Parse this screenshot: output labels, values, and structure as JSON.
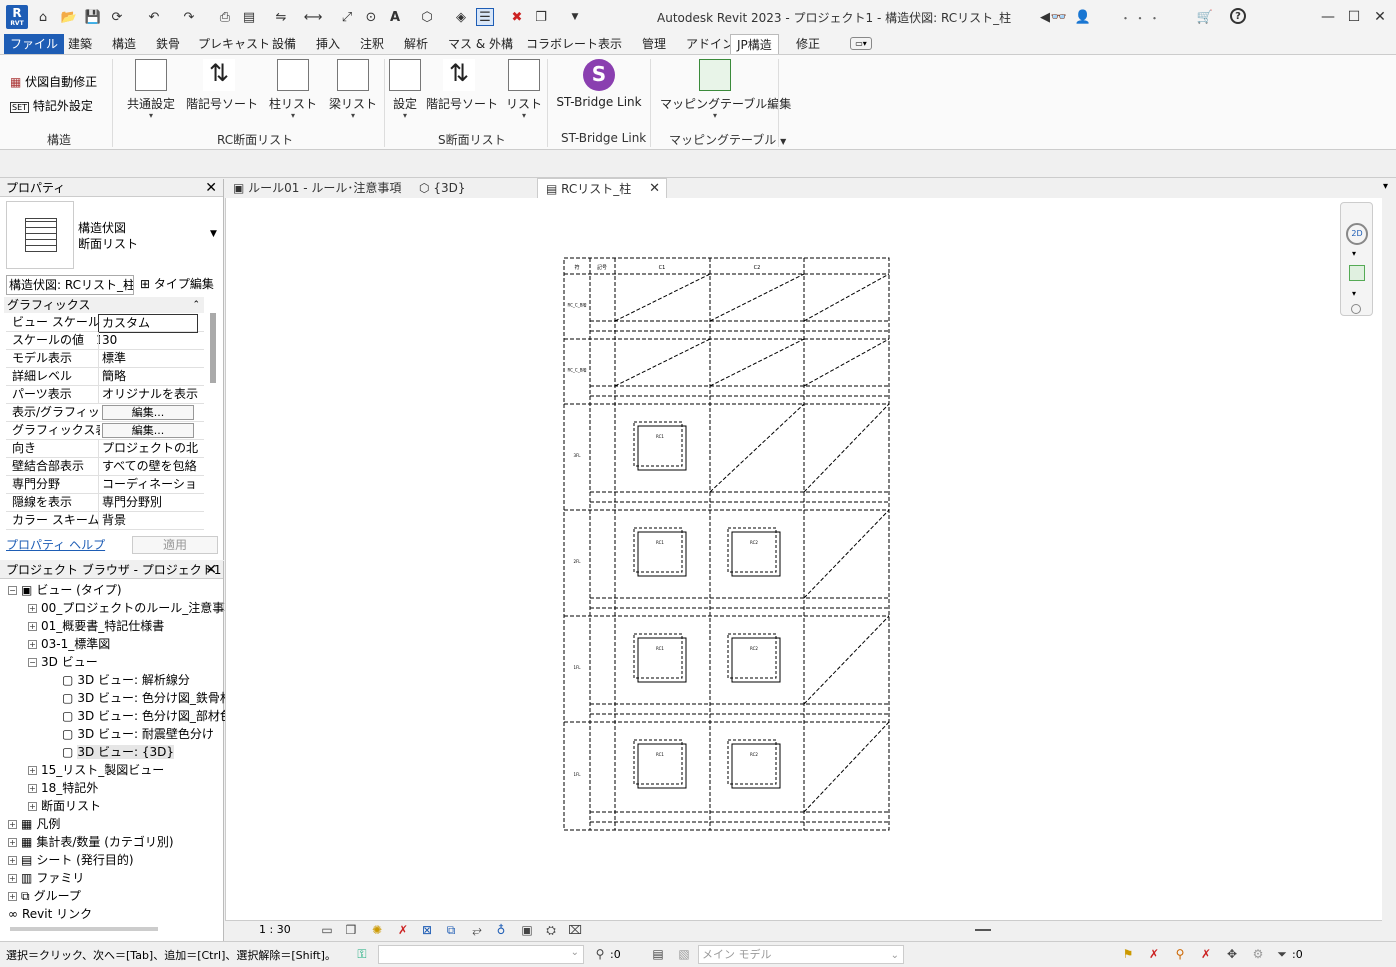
{
  "app": {
    "title": "Autodesk Revit 2023 - プロジェクト1 - 構造伏図: RCリスト_柱"
  },
  "quick_access": {
    "icons": [
      "open-icon",
      "save-icon",
      "sync-icon",
      "undo-icon",
      "redo-icon",
      "print-icon",
      "pdf-icon",
      "align-icon",
      "dimension-icon",
      "measure-icon",
      "tag-icon",
      "text-icon",
      "3d-view-icon",
      "section-icon",
      "thin-lines-icon",
      "close-hidden-icon",
      "switch-windows-icon",
      "customize-icon"
    ],
    "text_tool_label": "A"
  },
  "user": {
    "name": "・ ・ ・"
  },
  "menu": {
    "file": "ファイル",
    "tabs": [
      "建築",
      "構造",
      "鉄骨",
      "プレキャスト",
      "設備",
      "挿入",
      "注釈",
      "解析",
      "マス & 外構",
      "コラボレート",
      "表示",
      "管理",
      "アドイン",
      "JP構造",
      "修正"
    ],
    "active": "JP構造"
  },
  "ribbon": {
    "panel1": {
      "title": "構造",
      "items": [
        "伏図自動修正",
        "特記外設定"
      ]
    },
    "panel2": {
      "title": "RC断面リスト",
      "items": [
        "共通設定",
        "階記号ソート",
        "柱リスト",
        "梁リスト"
      ]
    },
    "panel3": {
      "title": "S断面リスト",
      "items": [
        "設定",
        "階記号ソート",
        "リスト"
      ]
    },
    "panel4": {
      "title": "ST-Bridge Link",
      "items": [
        "ST-Bridge Link"
      ]
    },
    "panel5": {
      "title": "マッピングテーブル",
      "items": [
        "マッピングテーブル編集"
      ]
    }
  },
  "properties": {
    "title": "プロパティ",
    "type_line1": "構造伏図",
    "type_line2": "断面リスト",
    "selector": "構造伏図: RCリスト_柱",
    "edit_type": "タイプ編集",
    "section": "グラフィックス",
    "rows": [
      {
        "k": "ビュー スケール",
        "v": "カスタム"
      },
      {
        "k": "スケールの値　1:",
        "v": "30"
      },
      {
        "k": "モデル表示",
        "v": "標準"
      },
      {
        "k": "詳細レベル",
        "v": "簡略"
      },
      {
        "k": "パーツ表示",
        "v": "オリジナルを表示"
      },
      {
        "k": "表示/グラフィッ...",
        "v": "編集..."
      },
      {
        "k": "グラフィックス表...",
        "v": "編集..."
      },
      {
        "k": "向き",
        "v": "プロジェクトの北"
      },
      {
        "k": "壁結合部表示",
        "v": "すべての壁を包絡"
      },
      {
        "k": "専門分野",
        "v": "コーディネーション"
      },
      {
        "k": "隠線を表示",
        "v": "専門分野別"
      },
      {
        "k": "カラー スキームの...",
        "v": "背景"
      }
    ],
    "help": "プロパティ ヘルプ",
    "apply": "適用"
  },
  "browser": {
    "title": "プロジェクト ブラウザ - プロジェクト1",
    "nodes": [
      {
        "t": "ビュー (タイプ)",
        "lvl": 0,
        "pm": "-"
      },
      {
        "t": "00_プロジェクトのルール_注意事項",
        "lvl": 1,
        "pm": "+"
      },
      {
        "t": "01_概要書_特記仕様書",
        "lvl": 1,
        "pm": "+"
      },
      {
        "t": "03-1_標準図",
        "lvl": 1,
        "pm": "+"
      },
      {
        "t": "3D ビュー",
        "lvl": 1,
        "pm": "-"
      },
      {
        "t": "3D ビュー: 解析線分",
        "lvl": 2,
        "pm": ""
      },
      {
        "t": "3D ビュー: 色分け図_鉄骨材",
        "lvl": 2,
        "pm": ""
      },
      {
        "t": "3D ビュー: 色分け図_部材色",
        "lvl": 2,
        "pm": ""
      },
      {
        "t": "3D ビュー: 耐震壁色分け",
        "lvl": 2,
        "pm": ""
      },
      {
        "t": "3D ビュー: {3D}",
        "lvl": 2,
        "pm": ""
      },
      {
        "t": "15_リスト_製図ビュー",
        "lvl": 1,
        "pm": "+"
      },
      {
        "t": "18_特記外",
        "lvl": 1,
        "pm": "+"
      },
      {
        "t": "断面リスト",
        "lvl": 1,
        "pm": "+"
      },
      {
        "t": "凡例",
        "lvl": 0,
        "pm": "+"
      },
      {
        "t": "集計表/数量 (カテゴリ別)",
        "lvl": 0,
        "pm": "+"
      },
      {
        "t": "シート (発行目的)",
        "lvl": 0,
        "pm": "+"
      },
      {
        "t": "ファミリ",
        "lvl": 0,
        "pm": "+"
      },
      {
        "t": "グループ",
        "lvl": 0,
        "pm": "+"
      },
      {
        "t": "Revit リンク",
        "lvl": 0,
        "pm": ""
      }
    ]
  },
  "view_tabs": [
    {
      "label": "ルール01 - ルール･注意事項"
    },
    {
      "label": "{3D}"
    },
    {
      "label": "RCリスト_柱"
    }
  ],
  "drawing": {
    "header": [
      "符",
      "記号",
      "C1",
      "C2"
    ],
    "rows": [
      "RC_C_B階",
      "RC_C_B階",
      "3FL",
      "2FL",
      "1FL",
      "1FL"
    ],
    "col_labels": [
      "RC1",
      "RC2"
    ]
  },
  "view_control": {
    "scale": "1 : 30"
  },
  "status": {
    "hint": "選択＝クリック、次へ＝[Tab]、追加＝[Ctrl]、選択解除＝[Shift]。",
    "count": ":0",
    "model": "メイン モデル",
    "filter": ":0"
  }
}
